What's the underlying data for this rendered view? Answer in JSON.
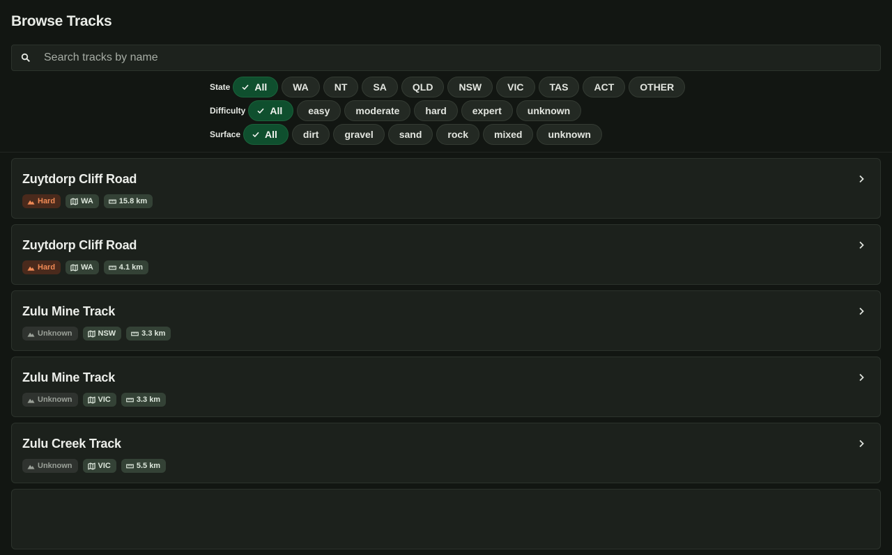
{
  "page": {
    "title": "Browse Tracks"
  },
  "search": {
    "placeholder": "Search tracks by name",
    "value": ""
  },
  "filters": {
    "state": {
      "label": "State",
      "options": [
        "All",
        "WA",
        "NT",
        "SA",
        "QLD",
        "NSW",
        "VIC",
        "TAS",
        "ACT",
        "OTHER"
      ],
      "selected": "All"
    },
    "difficulty": {
      "label": "Difficulty",
      "options": [
        "All",
        "easy",
        "moderate",
        "hard",
        "expert",
        "unknown"
      ],
      "selected": "All"
    },
    "surface": {
      "label": "Surface",
      "options": [
        "All",
        "dirt",
        "gravel",
        "sand",
        "rock",
        "mixed",
        "unknown"
      ],
      "selected": "All"
    }
  },
  "tracks": [
    {
      "name": "Zuytdorp Cliff Road",
      "difficulty": "Hard",
      "state": "WA",
      "length": "15.8 km"
    },
    {
      "name": "Zuytdorp Cliff Road",
      "difficulty": "Hard",
      "state": "WA",
      "length": "4.1 km"
    },
    {
      "name": "Zulu Mine Track",
      "difficulty": "Unknown",
      "state": "NSW",
      "length": "3.3 km"
    },
    {
      "name": "Zulu Mine Track",
      "difficulty": "Unknown",
      "state": "VIC",
      "length": "3.3 km"
    },
    {
      "name": "Zulu Creek Track",
      "difficulty": "Unknown",
      "state": "VIC",
      "length": "5.5 km"
    }
  ],
  "colors": {
    "background": "#121612",
    "selected_chip": "#0f4f2e",
    "hard": "#f08a55",
    "unknown": "#9aa098"
  },
  "icons": {
    "search": "search-icon",
    "check": "check-icon",
    "difficulty": "mountain-icon",
    "state": "map-icon",
    "length": "ruler-icon",
    "open": "chevron-right-icon"
  }
}
